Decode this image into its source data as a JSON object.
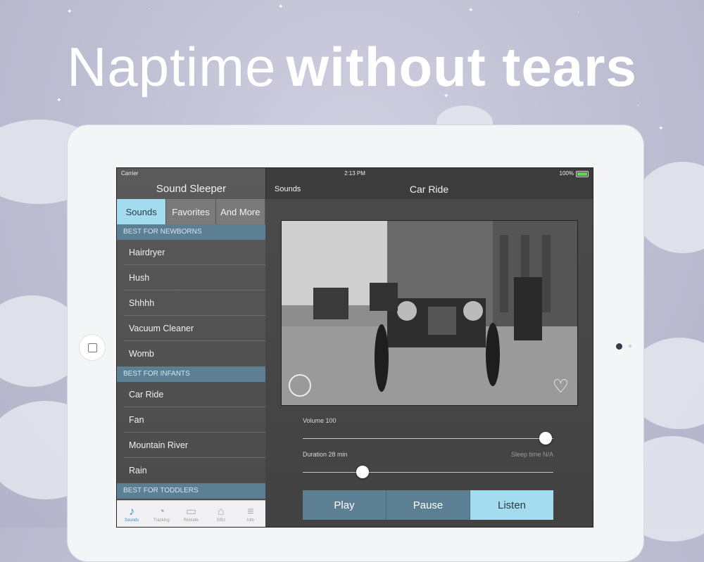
{
  "headline": {
    "light": "Naptime",
    "bold": "without tears"
  },
  "status": {
    "carrier": "Carrier",
    "time": "2:13 PM",
    "battery": "100%"
  },
  "sidebar": {
    "title": "Sound Sleeper",
    "segments": [
      "Sounds",
      "Favorites",
      "And More"
    ],
    "active_segment": "Sounds",
    "sections": [
      {
        "header": "BEST FOR NEWBORNS",
        "items": [
          "Hairdryer",
          "Hush",
          "Shhhh",
          "Vacuum Cleaner",
          "Womb"
        ]
      },
      {
        "header": "BEST FOR INFANTS",
        "items": [
          "Car Ride",
          "Fan",
          "Mountain River",
          "Rain"
        ]
      },
      {
        "header": "BEST FOR TODDLERS",
        "items": []
      }
    ]
  },
  "tabbar": {
    "tabs": [
      {
        "label": "Sounds",
        "icon": "sounds-icon"
      },
      {
        "label": "Tracking",
        "icon": "tracking-icon"
      },
      {
        "label": "Remote",
        "icon": "remote-icon"
      },
      {
        "label": "SSU",
        "icon": "ssu-icon"
      },
      {
        "label": "Info",
        "icon": "info-icon"
      }
    ],
    "active": "Sounds"
  },
  "nav": {
    "back": "Sounds",
    "title": "Car Ride"
  },
  "player": {
    "volume_label": "Volume 100",
    "volume_value": 100,
    "duration_label": "Duration 28 min",
    "duration_fraction": 0.24,
    "sleep_time": "Sleep time N/A",
    "buttons": [
      "Play",
      "Pause",
      "Listen"
    ],
    "active_button": "Listen"
  },
  "colors": {
    "accent": "#a3dcef",
    "section": "#5c7f94"
  }
}
